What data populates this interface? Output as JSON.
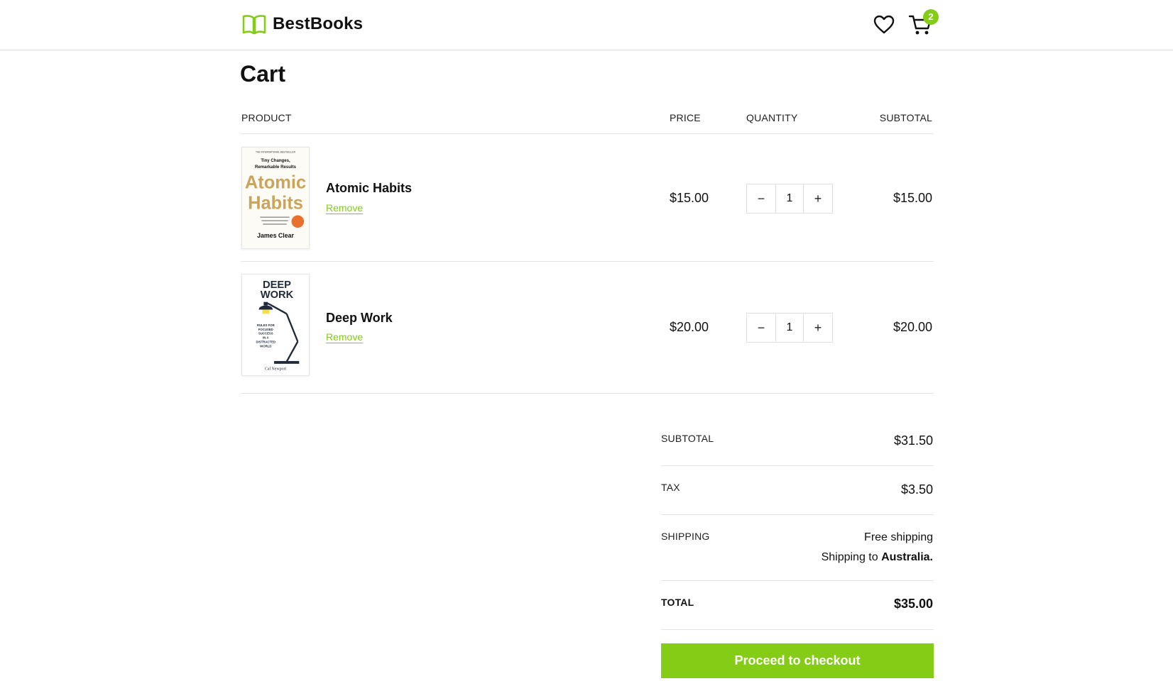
{
  "brand": {
    "name": "BestBooks",
    "icon": "open-book-icon",
    "accent": "#84cc16"
  },
  "header": {
    "wishlist_icon": "heart-icon",
    "cart_icon": "cart-icon",
    "cart_count": "2"
  },
  "page": {
    "title": "Cart"
  },
  "table": {
    "columns": {
      "product": "PRODUCT",
      "price": "PRICE",
      "quantity": "QUANTITY",
      "subtotal": "SUBTOTAL"
    },
    "items": [
      {
        "name": "Atomic Habits",
        "remove_label": "Remove",
        "price": "$15.00",
        "quantity": "1",
        "subtotal": "$15.00",
        "cover": {
          "tagline": "THE INTERNATIONAL BESTSELLER",
          "subtitle_1": "Tiny Changes,",
          "subtitle_2": "Remarkable Results",
          "title_1": "Atomic",
          "title_2": "Habits",
          "author": "James Clear"
        }
      },
      {
        "name": "Deep Work",
        "remove_label": "Remove",
        "price": "$20.00",
        "quantity": "1",
        "subtotal": "$20.00",
        "cover": {
          "title_1": "DEEP",
          "title_2": "WORK",
          "subtitle_1": "RULES FOR",
          "subtitle_2": "FOCUSED",
          "subtitle_3": "SUCCESS",
          "subtitle_4": "IN A",
          "subtitle_5": "DISTRACTED",
          "subtitle_6": "WORLD",
          "author": "Cal Newport"
        }
      }
    ],
    "decrement_symbol": "−",
    "increment_symbol": "+"
  },
  "summary": {
    "subtotal_label": "SUBTOTAL",
    "subtotal_value": "$31.50",
    "tax_label": "TAX",
    "tax_value": "$3.50",
    "shipping_label": "SHIPPING",
    "shipping_value": "Free shipping",
    "shipping_to_prefix": "Shipping to",
    "shipping_to_country": "Australia.",
    "total_label": "TOTAL",
    "total_value": "$35.00",
    "checkout_label": "Proceed to checkout"
  }
}
